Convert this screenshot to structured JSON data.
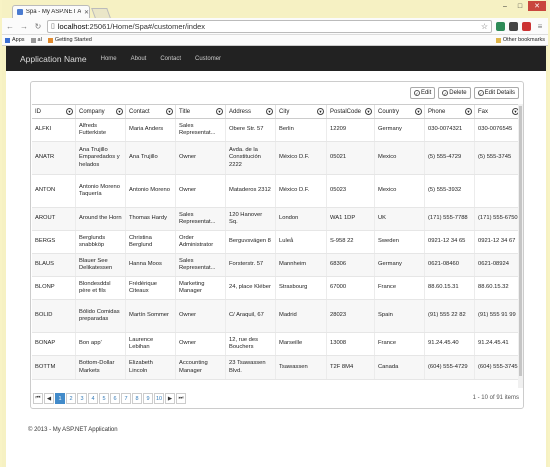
{
  "browser": {
    "tab_title": "Spa - My ASP.NET Applic",
    "url_host": "localhost",
    "url_rest": ":25061/Home/Spa#/customer/index",
    "bookmarks": [
      "Apps",
      "al",
      "Getting Started"
    ],
    "other_bookmarks": "Other bookmarks"
  },
  "nav": {
    "brand": "Application Name",
    "links": [
      "Home",
      "About",
      "Contact",
      "Customer"
    ]
  },
  "toolbar": {
    "edit": "Edit",
    "delete": "Delete",
    "edit_details": "Edit Details"
  },
  "grid": {
    "columns": [
      "ID",
      "Company",
      "Contact",
      "Title",
      "Address",
      "City",
      "PostalCode",
      "Country",
      "Phone",
      "Fax"
    ],
    "rows": [
      [
        "ALFKI",
        "Alfreds Futterkiste",
        "Maria Anders",
        "Sales Representat...",
        "Obere Str. 57",
        "Berlin",
        "12209",
        "Germany",
        "030-0074321",
        "030-0076545"
      ],
      [
        "ANATR",
        "Ana Trujillo Emparedados y helados",
        "Ana Trujillo",
        "Owner",
        "Avda. de la Constitución 2222",
        "México D.F.",
        "05021",
        "Mexico",
        "(5) 555-4729",
        "(5) 555-3745"
      ],
      [
        "ANTON",
        "Antonio Moreno Taquería",
        "Antonio Moreno",
        "Owner",
        "Mataderos 2312",
        "México D.F.",
        "05023",
        "Mexico",
        "(5) 555-3932",
        ""
      ],
      [
        "AROUT",
        "Around the Horn",
        "Thomas Hardy",
        "Sales Representat...",
        "120 Hanover Sq.",
        "London",
        "WA1 1DP",
        "UK",
        "(171) 555-7788",
        "(171) 555-6750"
      ],
      [
        "BERGS",
        "Berglunds snabbköp",
        "Christina Berglund",
        "Order Administrator",
        "Berguvsvägen 8",
        "Luleå",
        "S-958 22",
        "Sweden",
        "0921-12 34 65",
        "0921-12 34 67"
      ],
      [
        "BLAUS",
        "Blauer See Delikatessen",
        "Hanna Moos",
        "Sales Representat...",
        "Forsterstr. 57",
        "Mannheim",
        "68306",
        "Germany",
        "0621-08460",
        "0621-08924"
      ],
      [
        "BLONP",
        "Blondesddsl père et fils",
        "Frédérique Citeaux",
        "Marketing Manager",
        "24, place Kléber",
        "Strasbourg",
        "67000",
        "France",
        "88.60.15.31",
        "88.60.15.32"
      ],
      [
        "BOLID",
        "Bólido Comidas preparadas",
        "Martín Sommer",
        "Owner",
        "C/ Araquil, 67",
        "Madrid",
        "28023",
        "Spain",
        "(91) 555 22 82",
        "(91) 555 91 99"
      ],
      [
        "BONAP",
        "Bon app'",
        "Laurence Lebihan",
        "Owner",
        "12, rue des Bouchers",
        "Marseille",
        "13008",
        "France",
        "91.24.45.40",
        "91.24.45.41"
      ],
      [
        "BOTTM",
        "Bottom-Dollar Markets",
        "Elizabeth Lincoln",
        "Accounting Manager",
        "23 Tsawassen Blvd.",
        "Tsawassen",
        "T2F 8M4",
        "Canada",
        "(604) 555-4729",
        "(604) 555-3745"
      ]
    ]
  },
  "pager": {
    "first": "⏮",
    "prev": "◀",
    "pages": [
      "1",
      "2",
      "3",
      "4",
      "5",
      "6",
      "7",
      "8",
      "9",
      "10"
    ],
    "next": "▶",
    "last": "⏭",
    "info": "1 - 10 of 91 items"
  },
  "footer": "© 2013 - My ASP.NET Application"
}
